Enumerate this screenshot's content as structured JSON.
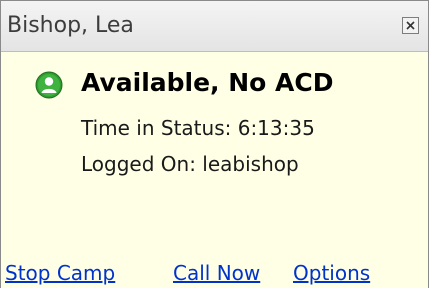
{
  "window": {
    "title": "Bishop, Lea",
    "close_icon": "close-icon"
  },
  "status": {
    "icon": "user-available-icon",
    "label": "Available, No ACD",
    "time_in_status": "Time in Status: 6:13:35",
    "logged_on": "Logged On: leabishop"
  },
  "actions": {
    "stop_camp": "Stop Camp",
    "call_now": "Call Now",
    "options": "Options"
  },
  "colors": {
    "background": "#ffffe6",
    "link": "#0033cc",
    "status_green": "#2f9a2f"
  }
}
